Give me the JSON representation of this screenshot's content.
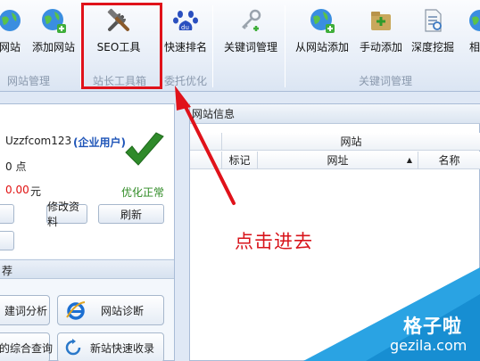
{
  "ribbon": {
    "buttons": [
      {
        "label": "网站",
        "icon": "globe-icon"
      },
      {
        "label": "添加网站",
        "icon": "globe-add-icon"
      },
      {
        "label": "SEO工具",
        "icon": "tools-icon"
      },
      {
        "label": "快速排名",
        "icon": "baidu-paw-icon"
      },
      {
        "label": "关键词管理",
        "icon": "key-icon"
      },
      {
        "label": "从网站添加",
        "icon": "globe-add-icon"
      },
      {
        "label": "手动添加",
        "icon": "folder-add-icon"
      },
      {
        "label": "深度挖掘",
        "icon": "document-icon"
      },
      {
        "label": "相关",
        "icon": "globe-icon"
      }
    ],
    "groups": [
      "网站管理",
      "站长工具箱",
      "委托优化",
      "关键词管理"
    ]
  },
  "account": {
    "username": "Uzzfcom123",
    "user_type": "(企业用户)",
    "points": "0 点",
    "balance": "0.00",
    "currency": "元",
    "status": "优化正常",
    "buttons": [
      "修改资料",
      "刷新"
    ],
    "section_title": "荐",
    "tools": [
      "建词分析",
      "网站诊断",
      "的综合查询",
      "新站快速收录"
    ]
  },
  "site_info": {
    "title": "网站信息",
    "group_header": "网站",
    "columns": [
      "标记",
      "网址",
      "名称"
    ]
  },
  "annotation": {
    "text": "点击进去",
    "color": "#d8141b"
  },
  "watermark": {
    "cn": "格子啦",
    "en": "gezila.com"
  }
}
